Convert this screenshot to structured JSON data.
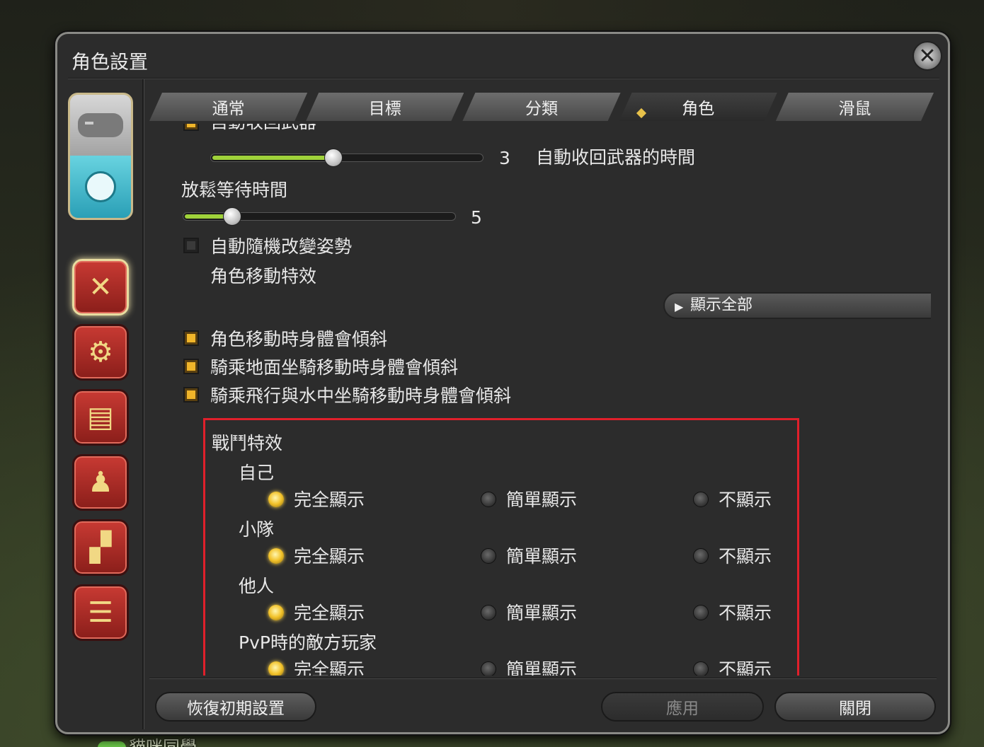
{
  "window": {
    "title": "角色設置"
  },
  "tabs": [
    {
      "label": "通常",
      "active": false
    },
    {
      "label": "目標",
      "active": false
    },
    {
      "label": "分類",
      "active": false
    },
    {
      "label": "角色",
      "active": true
    },
    {
      "label": "滑鼠",
      "active": false
    }
  ],
  "settings": {
    "partial_top_label": "自動收回武器",
    "weapon_slider": {
      "value": "3",
      "label": "自動收回武器的時間",
      "level": 0.45
    },
    "idle_label": "放鬆等待時間",
    "idle_slider": {
      "value": "5",
      "level": 0.18
    },
    "random_pose": {
      "label": "自動隨機改變姿勢",
      "checked": false
    },
    "move_effect_label": "角色移動特效",
    "show_all": "顯示全部",
    "tilt_walk": {
      "label": "角色移動時身體會傾斜",
      "checked": true
    },
    "tilt_ground_mount": {
      "label": "騎乘地面坐騎移動時身體會傾斜",
      "checked": true
    },
    "tilt_flying_mount": {
      "label": "騎乘飛行與水中坐騎移動時身體會傾斜",
      "checked": true
    }
  },
  "battle_effects": {
    "heading": "戰鬥特效",
    "options": [
      "完全顯示",
      "簡單顯示",
      "不顯示"
    ],
    "groups": [
      {
        "label": "自己",
        "selected": 0
      },
      {
        "label": "小隊",
        "selected": 0
      },
      {
        "label": "他人",
        "selected": 0
      },
      {
        "label": "PvP時的敵方玩家",
        "selected": 0
      }
    ]
  },
  "buttons": {
    "reset": "恢復初期設置",
    "apply": "應用",
    "close": "關閉"
  },
  "background": {
    "player_name": "貓咪同學"
  },
  "colors": {
    "accent": "#f0b52a",
    "highlight_box": "#e0202b",
    "slider_fill": "#9fd23a"
  }
}
